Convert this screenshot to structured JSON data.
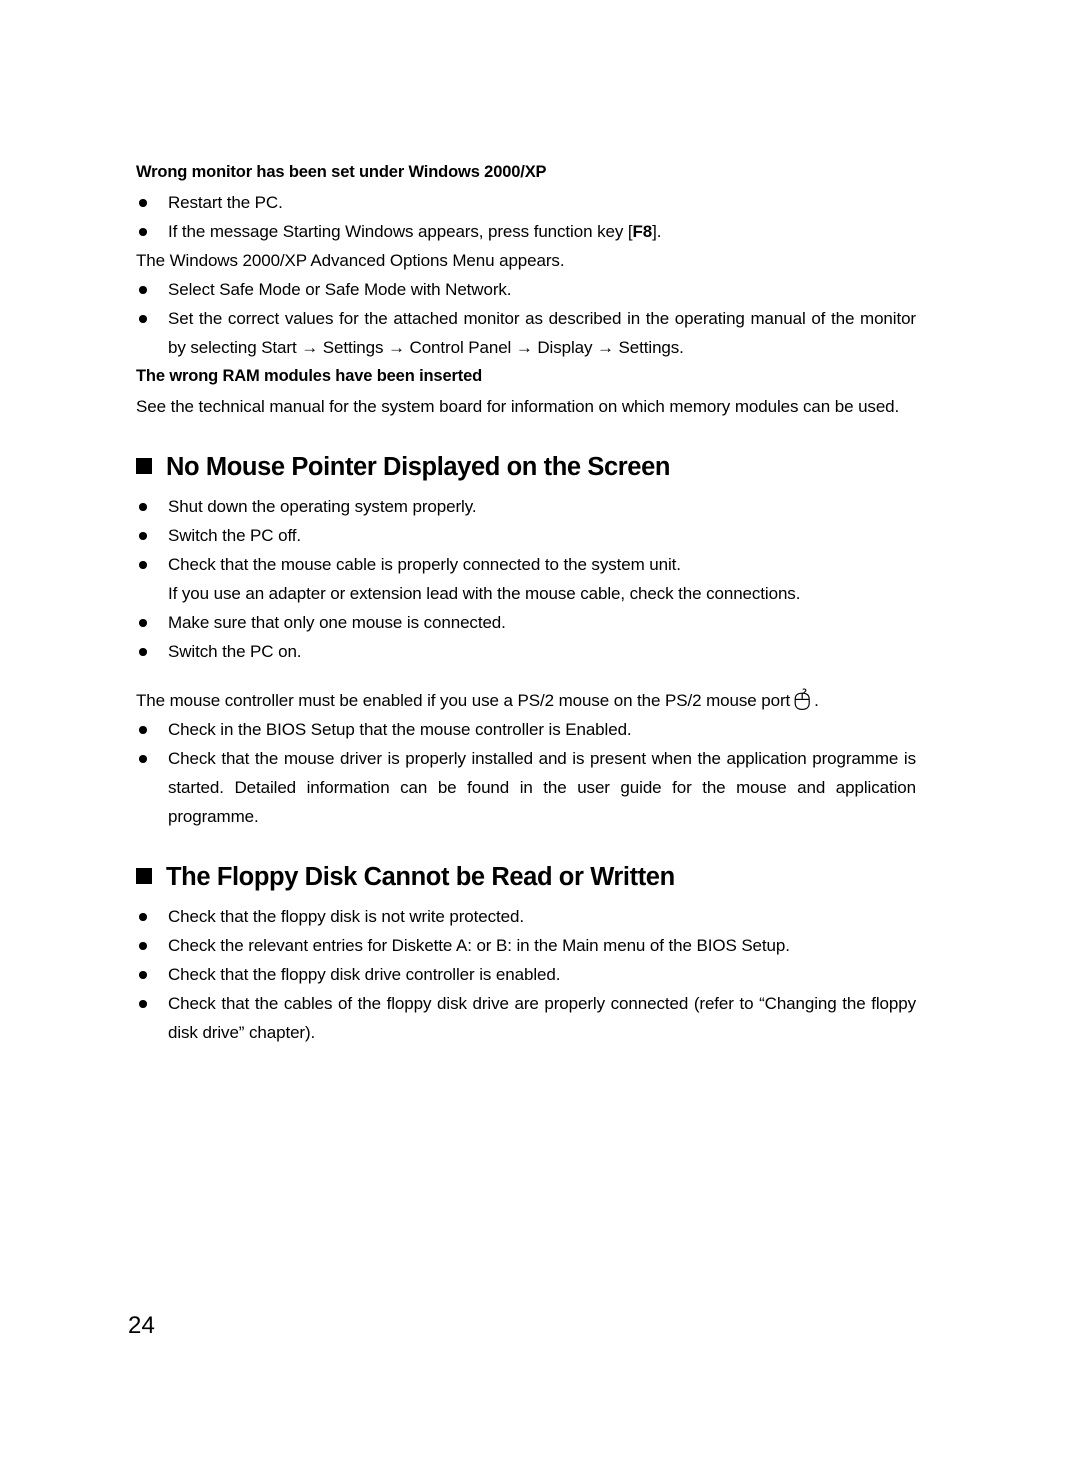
{
  "document": {
    "page_number": "24",
    "sections": [
      {
        "id": "wrong-monitor",
        "heading": "Wrong monitor has been set under Windows 2000/XP",
        "bullets_1": [
          "Restart the PC.",
          "If the message Starting Windows appears, press function key [F8]."
        ],
        "note": "The Windows 2000/XP Advanced Options Menu appears.",
        "bullets_2": [
          "Select Safe Mode or Safe Mode with Network.",
          "Set the correct values for the attached monitor as described in the operating manual of the monitor by selecting Start → Settings → Control Panel → Display → Settings."
        ]
      },
      {
        "id": "wrong-ram",
        "heading": "The wrong RAM modules have been inserted",
        "note": "See the technical manual for the system board for information on which memory modules can be used."
      },
      {
        "id": "no-mouse-pointer",
        "heading": "No Mouse Pointer Displayed on the Screen",
        "bullets_1": [
          "Shut down the operating system properly.",
          "Switch the PC off.",
          "Check that the mouse cable is properly connected to the system unit."
        ],
        "sub_note": "If you use an adapter or extension lead with the mouse cable, check the connections.",
        "bullets_2": [
          "Make sure that only one mouse is connected.",
          "Switch the PC on."
        ],
        "note_prefix": "The mouse controller must be enabled if you use a PS/2 mouse on the PS/2 mouse port",
        "note_suffix": ".",
        "bullets_3": [
          "Check in the BIOS Setup that the mouse controller is Enabled.",
          "Check that the mouse driver is properly installed and is present when the application programme is started. Detailed information can be found in the user guide for the mouse and application programme."
        ]
      },
      {
        "id": "floppy-disk",
        "heading": "The Floppy Disk Cannot be Read or Written",
        "bullets_1": [
          "Check that the floppy disk is not write protected.",
          "Check the relevant entries for Diskette A: or B: in the Main menu of the BIOS Setup.",
          "Check that the floppy disk drive controller is enabled.",
          "Check that the cables of the floppy disk drive are properly connected (refer to “Changing the floppy disk drive” chapter)."
        ]
      }
    ],
    "inline": {
      "f8_key_prefix": "If the message Starting Windows appears, press function key [",
      "f8_key_label": "F8",
      "f8_key_suffix": "]."
    },
    "icons": {
      "ps2_mouse_port": "mouse-port-icon"
    }
  }
}
